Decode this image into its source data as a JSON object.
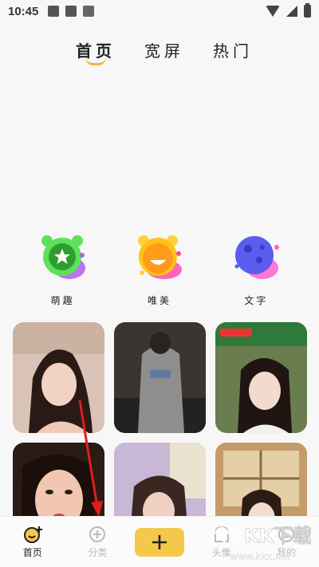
{
  "status_bar": {
    "time": "10:45"
  },
  "top_tabs": [
    {
      "label": "首页",
      "active": true
    },
    {
      "label": "宽屏",
      "active": false
    },
    {
      "label": "热门",
      "active": false
    }
  ],
  "categories": [
    {
      "label": "萌趣",
      "icon": "green-star-monster-icon",
      "color": "#3fc23a"
    },
    {
      "label": "唯美",
      "icon": "orange-bear-icon",
      "color": "#f7a52a"
    },
    {
      "label": "文字",
      "icon": "purple-planet-icon",
      "color": "#5b5cf0"
    }
  ],
  "bottom_nav": {
    "home": "首页",
    "category": "分类",
    "avatar": "头像",
    "mine": "我的"
  },
  "watermark": {
    "text": "KK下载",
    "url": "www.kkx.net"
  },
  "colors": {
    "accent": "#f5c84c",
    "arrow": "#e11d1d"
  }
}
